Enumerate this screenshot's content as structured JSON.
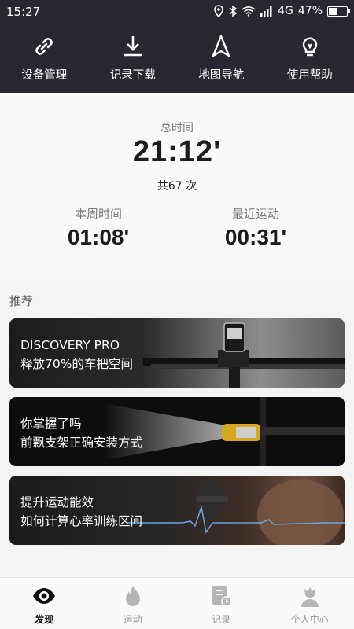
{
  "status_bar": {
    "time": "15:27",
    "network": "4G",
    "battery": "47%",
    "battery_level": 0.47,
    "icons": [
      "location-icon",
      "bluetooth-icon",
      "wifi-icon",
      "signal-icon",
      "battery-icon"
    ]
  },
  "top_nav": {
    "items": [
      {
        "label": "设备管理",
        "icon": "link-icon"
      },
      {
        "label": "记录下载",
        "icon": "download-icon"
      },
      {
        "label": "地图导航",
        "icon": "navigation-icon"
      },
      {
        "label": "使用帮助",
        "icon": "lightbulb-icon"
      }
    ]
  },
  "stats": {
    "total_label": "总时间",
    "total_value": "21:12'",
    "total_count": "共67 次",
    "week_label": "本周时间",
    "week_value": "01:08'",
    "recent_label": "最近运动",
    "recent_value": "00:31'"
  },
  "recommend": {
    "title": "推荐",
    "cards": [
      {
        "line1": "DISCOVERY PRO",
        "line2": "释放70%的车把空间"
      },
      {
        "line1": "你掌握了吗",
        "line2": "前飘支架正确安装方式"
      },
      {
        "line1": "提升运动能效",
        "line2": "如何计算心率训练区间"
      }
    ]
  },
  "tabs": [
    {
      "label": "发现",
      "icon": "eye-icon",
      "active": true
    },
    {
      "label": "运动",
      "icon": "flame-icon",
      "active": false
    },
    {
      "label": "记录",
      "icon": "record-list-icon",
      "active": false
    },
    {
      "label": "个人中心",
      "icon": "person-icon",
      "active": false
    }
  ],
  "colors": {
    "header_bg": "#2b2730",
    "tab_active": "#111111",
    "tab_inactive": "#999999"
  }
}
